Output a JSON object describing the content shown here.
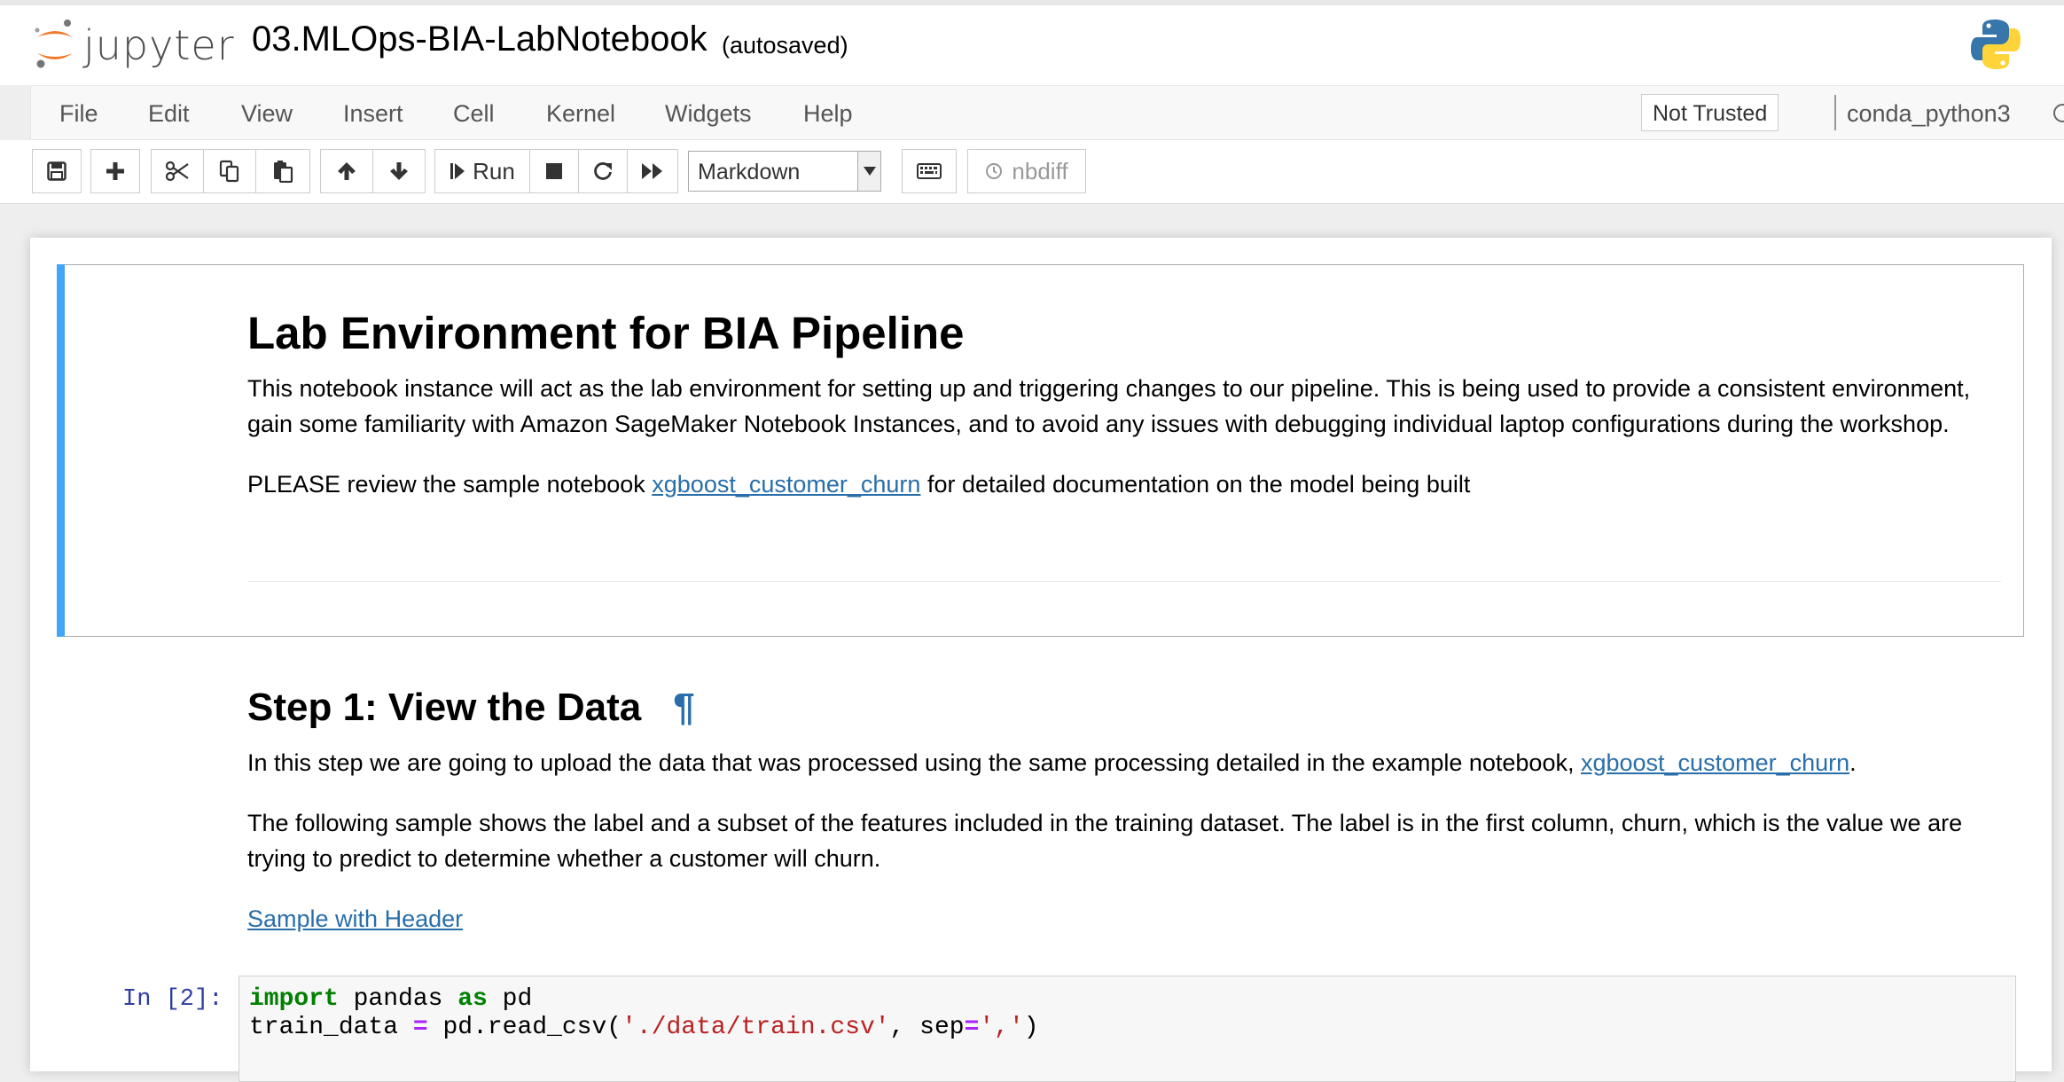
{
  "header": {
    "logo_text": "jupyter",
    "notebook_name": "03.MLOps-BIA-LabNotebook",
    "autosave_status": "(autosaved)"
  },
  "menubar": {
    "items": [
      "File",
      "Edit",
      "View",
      "Insert",
      "Cell",
      "Kernel",
      "Widgets",
      "Help"
    ],
    "trust_status": "Not Trusted",
    "kernel_name": "conda_python3"
  },
  "toolbar": {
    "run_label": "Run",
    "cell_type": "Markdown",
    "nbdiff_label": "nbdiff"
  },
  "cells": {
    "intro": {
      "heading": "Lab Environment for BIA Pipeline",
      "paragraph": "This notebook instance will act as the lab environment for setting up and triggering changes to our pipeline. This is being used to provide a consistent environment, gain some familiarity with Amazon SageMaker Notebook Instances, and to avoid any issues with debugging individual laptop configurations during the workshop.",
      "review_prefix": "PLEASE review the sample notebook ",
      "review_link": "xgboost_customer_churn",
      "review_suffix": " for detailed documentation on the model being built"
    },
    "step1": {
      "heading": "Step 1: View the Data",
      "anchor": "¶",
      "p1_prefix": "In this step we are going to upload the data that was processed using the same processing detailed in the example notebook, ",
      "p1_link": "xgboost_customer_churn",
      "p1_suffix": ".",
      "p2": "The following sample shows the label and a subset of the features included in the training dataset. The label is in the first column, churn, which is the value we are trying to predict to determine whether a customer will churn.",
      "sample_link": "Sample with Header"
    },
    "code": {
      "prompt": "In [2]:",
      "line1": {
        "kw1": "import",
        "mid": " pandas ",
        "kw2": "as",
        "end": " pd"
      },
      "line2": {
        "a": "train_data ",
        "eq": "=",
        "b": " pd.read_csv(",
        "s1": "'./data/train.csv'",
        "c": ", sep",
        "eq2": "=",
        "s2": "','",
        "d": ")"
      }
    }
  },
  "colors": {
    "selected_cell_bar": "#42a5f5",
    "link": "#296eaa",
    "prompt": "#303f9f"
  }
}
